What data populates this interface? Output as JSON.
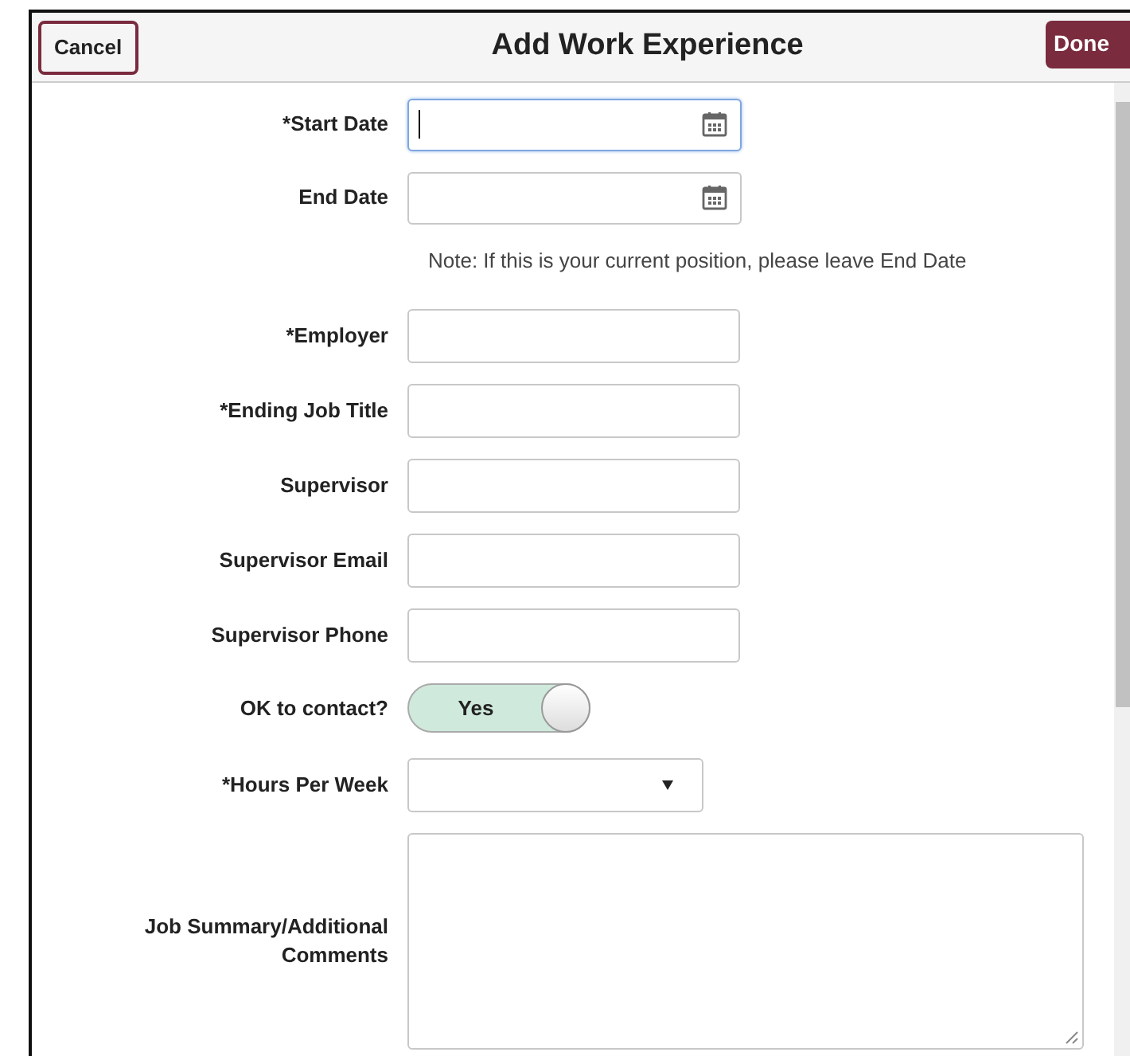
{
  "header": {
    "cancel": "Cancel",
    "title": "Add Work Experience",
    "done": "Done"
  },
  "rows": [
    {
      "kind": "date",
      "label": "*Start Date",
      "focused": true
    },
    {
      "kind": "date",
      "label": "End Date",
      "focused": false
    },
    {
      "kind": "note",
      "text": "Note:  If this is your current position, please leave End Date"
    },
    {
      "kind": "text",
      "label": "*Employer",
      "focused": false
    },
    {
      "kind": "text",
      "label": "*Ending Job Title",
      "focused": false
    },
    {
      "kind": "text",
      "label": "Supervisor",
      "focused": false
    },
    {
      "kind": "text",
      "label": "Supervisor Email",
      "focused": false
    },
    {
      "kind": "text",
      "label": "Supervisor Phone",
      "focused": false
    },
    {
      "kind": "toggle",
      "label": "OK to contact?",
      "on": true,
      "value": "Yes"
    },
    {
      "kind": "select",
      "label": "*Hours Per Week",
      "focused": false
    },
    {
      "kind": "textarea",
      "label": "Job Summary/Additional Comments",
      "focused": false
    }
  ]
}
